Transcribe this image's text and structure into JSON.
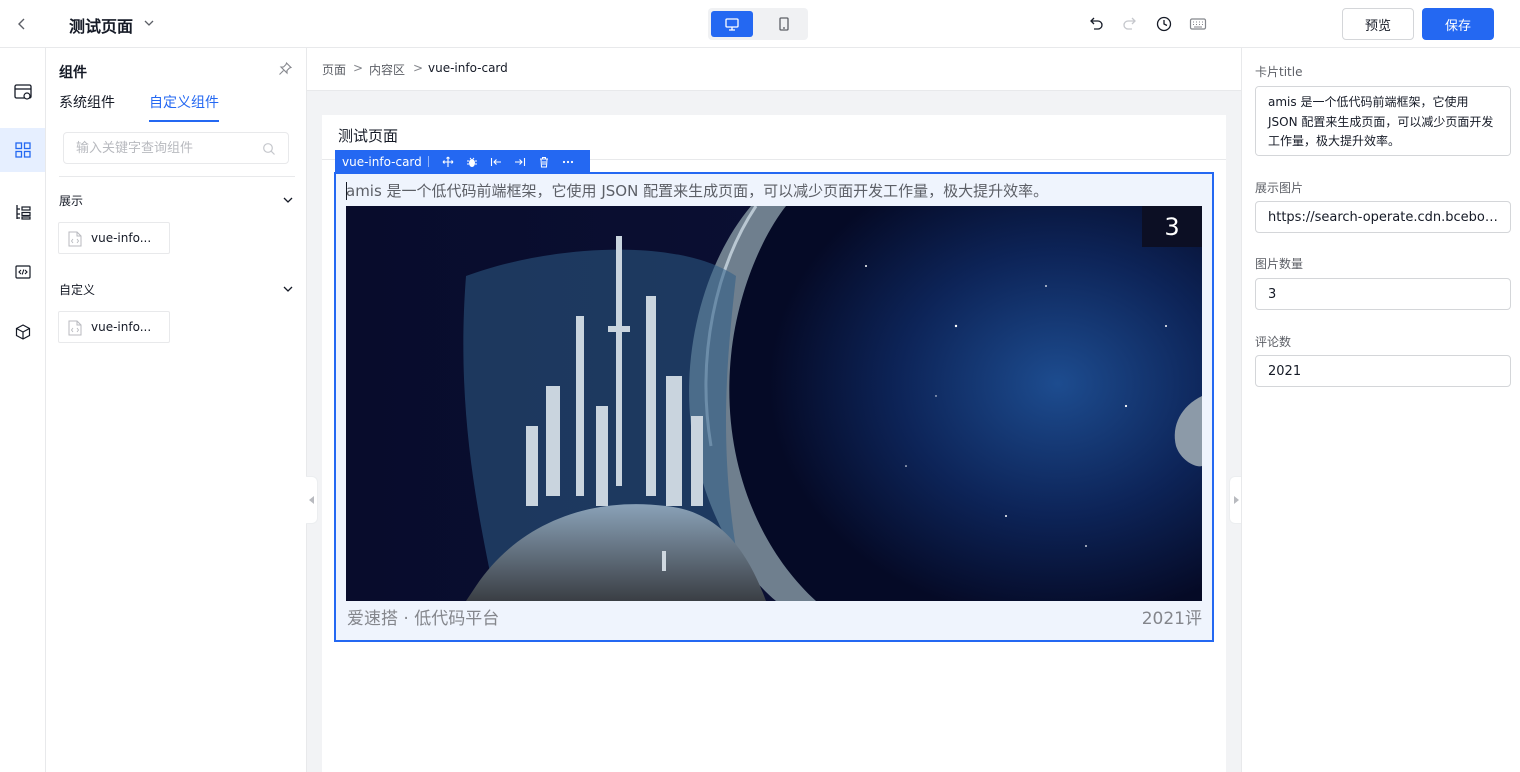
{
  "header": {
    "title": "测试页面",
    "preview_label": "预览",
    "save_label": "保存",
    "active_device": "pc"
  },
  "rail": {
    "items": [
      "page-settings-icon",
      "components-icon",
      "outline-icon",
      "code-icon",
      "cube-icon"
    ],
    "active_index": 1
  },
  "component_panel": {
    "title": "组件",
    "tabs": [
      "系统组件",
      "自定义组件"
    ],
    "active_tab": 1,
    "search_placeholder": "输入关键字查询组件",
    "groups": [
      {
        "name": "展示",
        "items": [
          "vue-info..."
        ]
      },
      {
        "name": "自定义",
        "items": [
          "vue-info..."
        ]
      }
    ]
  },
  "breadcrumb": [
    "页面",
    ">",
    "内容区",
    ">",
    "vue-info-card"
  ],
  "canvas": {
    "page_title": "测试页面",
    "toolbar_name": "vue-info-card",
    "card": {
      "title": "amis 是一个低代码前端框架，它使用 JSON 配置来生成页面，可以减少页面开发工作量，极大提升效率。",
      "image_count": "3",
      "footer_left": "爱速搭 · 低代码平台",
      "footer_right": "2021评"
    }
  },
  "props": {
    "fields": [
      {
        "label": "卡片title",
        "value": "amis 是一个低代码前端框架，它使用 JSON 配置来生成页面，可以减少页面开发工作量，极大提升效率。"
      },
      {
        "label": "展示图片",
        "value": "https://search-operate.cdn.bcebos.com"
      },
      {
        "label": "图片数量",
        "value": "3"
      },
      {
        "label": "评论数",
        "value": "2021"
      }
    ]
  },
  "colors": {
    "primary": "#2468f2",
    "selected_bg": "#eff4fd",
    "canvas_bg": "#f2f3f5"
  }
}
